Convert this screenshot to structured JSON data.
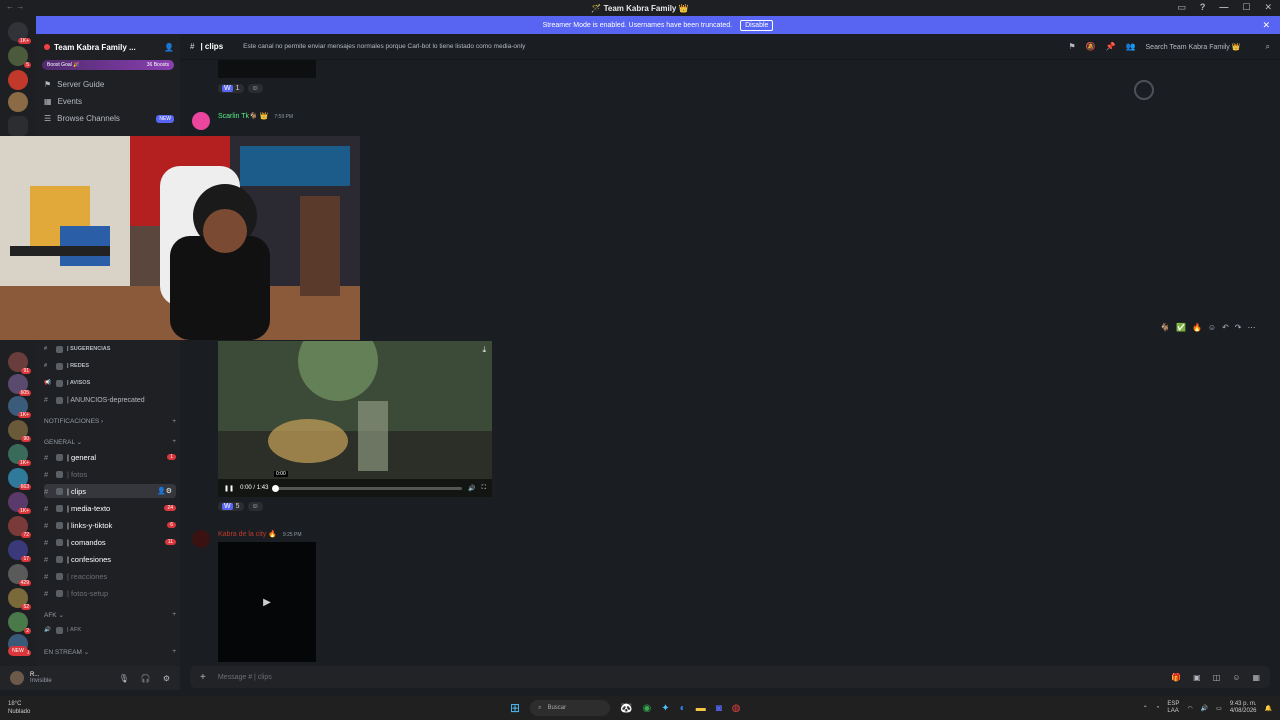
{
  "window": {
    "title": "🪄 Team Kabra Family 👑"
  },
  "banner": {
    "text": "Streamer Mode is enabled. Usernames have been truncated.",
    "button": "Disable"
  },
  "guild_badges": [
    "1K+",
    "5",
    "",
    "",
    "",
    "91",
    "605",
    "1K+",
    "90",
    "1K+",
    "18",
    "663",
    "1K+",
    "72",
    "17",
    "429",
    "52",
    "2",
    "468",
    "NEW"
  ],
  "server": {
    "name": "Team Kabra Family ...",
    "boost_label": "Boost Goal 🎉",
    "boosts": "36 Boosts"
  },
  "nav": {
    "guide": "Server Guide",
    "events": "Events",
    "browse": "Browse Channels",
    "new_badge": "NEW"
  },
  "channels": {
    "sugerencias": "| SUGERENCIAS",
    "redes": "| REDES",
    "avisos": "| AVISOS",
    "anuncios": "| ANUNCIOS-deprecated",
    "cat_notif": "NOTIFICACIONES ›",
    "cat_general": "GENERAL ⌄",
    "general": "| general",
    "general_count": "1",
    "fotos": "| fotos",
    "clips": "| clips",
    "media": "| media-texto",
    "media_count": "24",
    "links": "| links-y-tiktok",
    "links_count": "6",
    "comandos": "| comandos",
    "comandos_count": "11",
    "confesiones": "| confesiones",
    "reacciones": "| reacciones",
    "fotossetup": "| fotos-setup",
    "cat_afk": "AFK ⌄",
    "afk": "| AFK",
    "cat_stream": "EN STREAM ⌄"
  },
  "user": {
    "name": "R...",
    "status": "Invisible"
  },
  "topbar": {
    "channel": "| clips",
    "topic": "Este canal no permite enviar mensajes normales porque Carl-bot lo tiene listado como media-only",
    "search": "Search Team Kabra Family 👑"
  },
  "messages": {
    "m1_author": "Scarlin Tk🐐 👑",
    "m1_time": "7:59 PM",
    "reaction1_count": "1",
    "video_time": "0:00 / 1:43",
    "video_tooltip": "0:00",
    "reaction2_count": "5",
    "m2_author": "Kabra de la city 🔥",
    "m2_time": "9:25 PM"
  },
  "composer": {
    "placeholder": "Message # | clips"
  },
  "taskbar": {
    "weather_temp": "18°C",
    "weather_desc": "Nublado",
    "search": "Buscar",
    "lang": "ESP",
    "lang2": "LAA",
    "time": "9:43 p. m.",
    "date": "4/08/2026"
  }
}
